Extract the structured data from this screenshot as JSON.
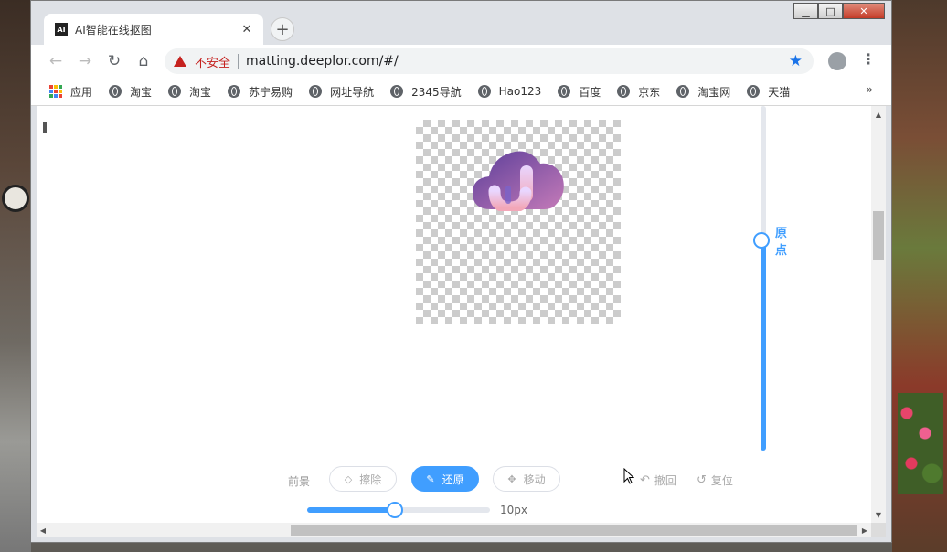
{
  "window": {
    "minimize": "▁",
    "maximize": "□",
    "close": "✕"
  },
  "tab": {
    "favicon": "AI",
    "title": "AI智能在线抠图",
    "close": "✕",
    "new_tab": "+"
  },
  "toolbar": {
    "back": "←",
    "forward": "→",
    "reload": "↻",
    "home": "⌂",
    "security_label": "不安全",
    "url": "matting.deeplor.com/#/",
    "bookmark_star": "★",
    "menu": "⋮"
  },
  "bookmarks": {
    "apps_label": "应用",
    "items": [
      "淘宝",
      "淘宝",
      "苏宁易购",
      "网址导航",
      "2345导航",
      "Hao123",
      "百度",
      "京东",
      "淘宝网",
      "天猫"
    ],
    "more": "»"
  },
  "editor": {
    "zoom_label": "原点",
    "foreground_label": "前景",
    "erase_label": "擦除",
    "restore_label": "还原",
    "move_label": "移动",
    "undo_label": "撤回",
    "reset_label": "复位",
    "brush_size": "10px",
    "brush_fraction": 0.48,
    "zoom_fraction": 0.61,
    "active_tool": "restore",
    "accent_color": "#409eff"
  },
  "icons": {
    "erase": "eraser-icon",
    "restore": "pencil-icon",
    "move": "move-icon",
    "undo": "undo-icon",
    "reset": "reset-icon"
  }
}
